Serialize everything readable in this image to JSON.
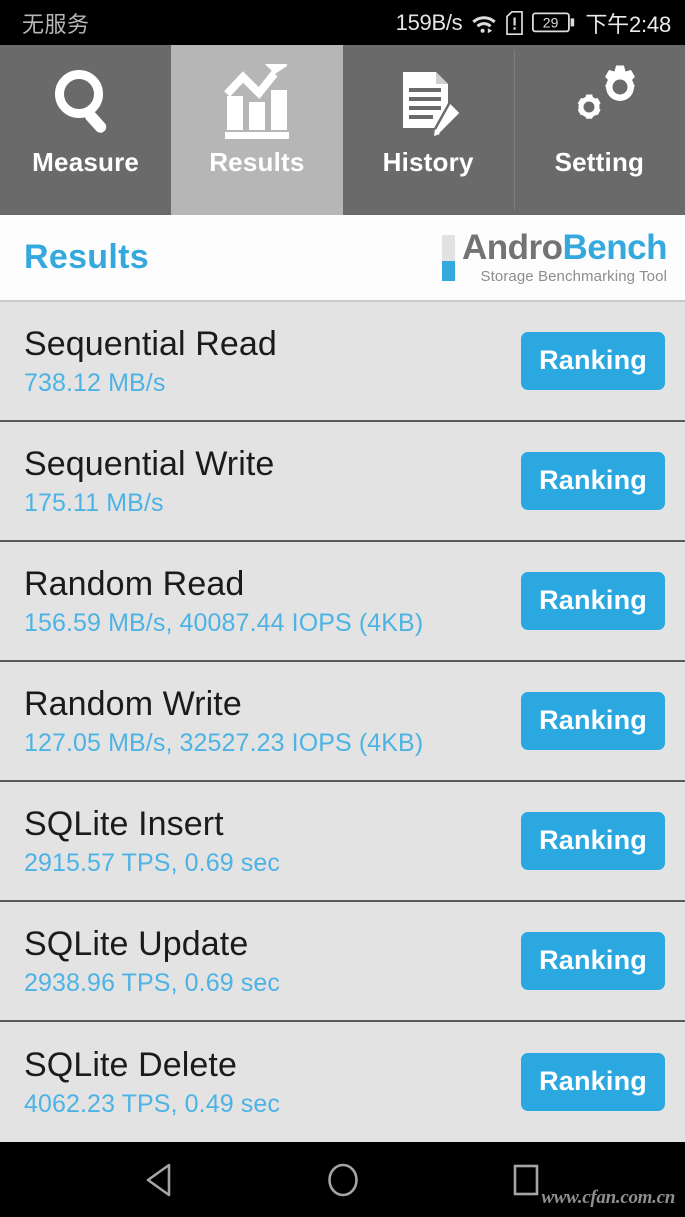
{
  "status_bar": {
    "carrier": "无服务",
    "network_speed": "159B/s",
    "wifi_icon": "wifi-icon",
    "sim_icon": "sim-card-alert-icon",
    "battery_level": "29",
    "battery_icon": "battery-icon",
    "time": "下午2:48"
  },
  "tabs": [
    {
      "label": "Measure",
      "icon": "magnifier-icon",
      "active": false
    },
    {
      "label": "Results",
      "icon": "bar-chart-arrow-icon",
      "active": true
    },
    {
      "label": "History",
      "icon": "document-pencil-icon",
      "active": false
    },
    {
      "label": "Setting",
      "icon": "gears-icon",
      "active": false
    }
  ],
  "header": {
    "title": "Results",
    "logo_primary": "Andro",
    "logo_secondary": "Bench",
    "logo_tagline": "Storage Benchmarking Tool"
  },
  "results": [
    {
      "name": "Sequential Read",
      "value": "738.12 MB/s",
      "action": "Ranking"
    },
    {
      "name": "Sequential Write",
      "value": "175.11 MB/s",
      "action": "Ranking"
    },
    {
      "name": "Random Read",
      "value": "156.59 MB/s, 40087.44 IOPS (4KB)",
      "action": "Ranking"
    },
    {
      "name": "Random Write",
      "value": "127.05 MB/s, 32527.23 IOPS (4KB)",
      "action": "Ranking"
    },
    {
      "name": "SQLite Insert",
      "value": "2915.57 TPS, 0.69 sec",
      "action": "Ranking"
    },
    {
      "name": "SQLite Update",
      "value": "2938.96 TPS, 0.69 sec",
      "action": "Ranking"
    },
    {
      "name": "SQLite Delete",
      "value": "4062.23 TPS, 0.49 sec",
      "action": "Ranking"
    }
  ],
  "nav_bar": {
    "back_icon": "back-triangle-icon",
    "home_icon": "home-circle-icon",
    "recents_icon": "recents-square-icon",
    "watermark": "www.cfan.com.cn"
  },
  "colors": {
    "accent_blue": "#2BA8E0",
    "subtitle_blue": "#4DB3E4",
    "title_blue": "#35A9DD",
    "tab_inactive": "#6A6A6A",
    "tab_active": "#B6B6B6",
    "list_bg": "#E3E3E3",
    "row_divider": "#58595B",
    "logo_gray": "#737373"
  }
}
